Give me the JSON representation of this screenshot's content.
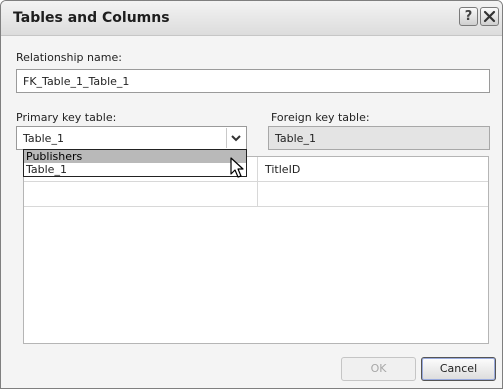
{
  "dialog": {
    "title": "Tables and Columns",
    "help_button": "?",
    "close_button": "X"
  },
  "relationship": {
    "label": "Relationship name:",
    "value": "FK_Table_1_Table_1"
  },
  "primary_key": {
    "label": "Primary key table:",
    "selected": "Table_1",
    "options": [
      "Publishers",
      "Table_1"
    ],
    "highlighted_option": "Publishers"
  },
  "foreign_key": {
    "label": "Foreign key table:",
    "value": "Table_1"
  },
  "columns_grid": {
    "rows": [
      {
        "primary": "",
        "foreign": "TitleID"
      },
      {
        "primary": "",
        "foreign": ""
      }
    ]
  },
  "buttons": {
    "ok": "OK",
    "cancel": "Cancel"
  },
  "colors": {
    "highlight": "#b9b9b9",
    "disabled_text": "#a8a8a8",
    "readonly_background": "#e4e4e4"
  }
}
